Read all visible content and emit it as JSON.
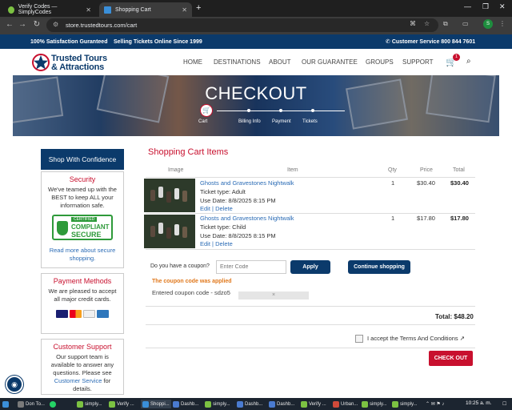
{
  "browser": {
    "tabs": [
      {
        "title": "Verify Codes — SimplyCodes",
        "active": false
      },
      {
        "title": "Shopping Cart",
        "active": true
      }
    ],
    "url": "store.trustedtours.com/cart",
    "profile_initial": "S"
  },
  "topstrip": {
    "satisfaction": "100% Satisfaction Guranteed",
    "since": "Selling Tickets Online Since 1999",
    "phone": "Customer Service 800 844 7601"
  },
  "header": {
    "logo_line1": "Trusted Tours",
    "logo_line2": "& Attractions",
    "nav": [
      "HOME",
      "DESTINATIONS",
      "ABOUT",
      "OUR GUARANTEE",
      "GROUPS",
      "SUPPORT"
    ],
    "cart_count": "1"
  },
  "banner": {
    "title": "CHECKOUT",
    "steps": [
      "Cart",
      "Billing Info",
      "Payment",
      "Tickets"
    ]
  },
  "sidebar": {
    "heading": "Shop With Confidence",
    "security": {
      "title": "Security",
      "text": "We've teamed up with the BEST to keep ALL your information safe.",
      "badge_top": "CERTIFIED",
      "badge_mid": "COMPLIANT",
      "badge_bot": "SECURE",
      "link": "Read more about secure shopping."
    },
    "payment": {
      "title": "Payment Methods",
      "text": "We are pleased to accept all major credit cards."
    },
    "support": {
      "title": "Customer Support",
      "text": "Our support team is available to answer any questions. Please see",
      "link": "Customer Service",
      "tail": "for details."
    }
  },
  "cart": {
    "title": "Shopping Cart Items",
    "columns": [
      "Image",
      "Item",
      "Qty",
      "Price",
      "Total"
    ],
    "items": [
      {
        "name": "Ghosts and Gravestones Nightwalk",
        "ticket": "Ticket type: Adult",
        "date": "Use Date: 8/8/2025 8:15 PM",
        "edit": "Edit",
        "delete": "Delete",
        "qty": "1",
        "price": "$30.40",
        "total": "$30.40"
      },
      {
        "name": "Ghosts and Gravestones Nightwalk",
        "ticket": "Ticket type: Child",
        "date": "Use Date: 8/8/2025 8:15 PM",
        "edit": "Edit",
        "delete": "Delete",
        "qty": "1",
        "price": "$17.80",
        "total": "$17.80"
      }
    ],
    "coupon_label": "Do you have a coupon?",
    "coupon_placeholder": "Enter Code",
    "apply": "Apply",
    "continue": "Continue shopping",
    "applied_msg": "The coupon code was applied",
    "entered_label": "Entered coupon code - sdzo5",
    "chip_close": "×",
    "grand_total": "Total: $48.20",
    "terms_prefix": "I accept the",
    "terms_link": "Terms And Conditions",
    "checkout": "CHECK OUT"
  },
  "taskbar": {
    "items": [
      "Don To...",
      "simply...",
      "Verify ...",
      "Shoppi...",
      "Dashb...",
      "simply...",
      "Dashb...",
      "Dashb...",
      "Verify ...",
      "Urban...",
      "simply...",
      "simply..."
    ],
    "clock": "10:25 a. m."
  },
  "colors": {
    "brand_blue": "#0b3a6b",
    "brand_red": "#c8102e",
    "link_blue": "#2a6bb5"
  }
}
